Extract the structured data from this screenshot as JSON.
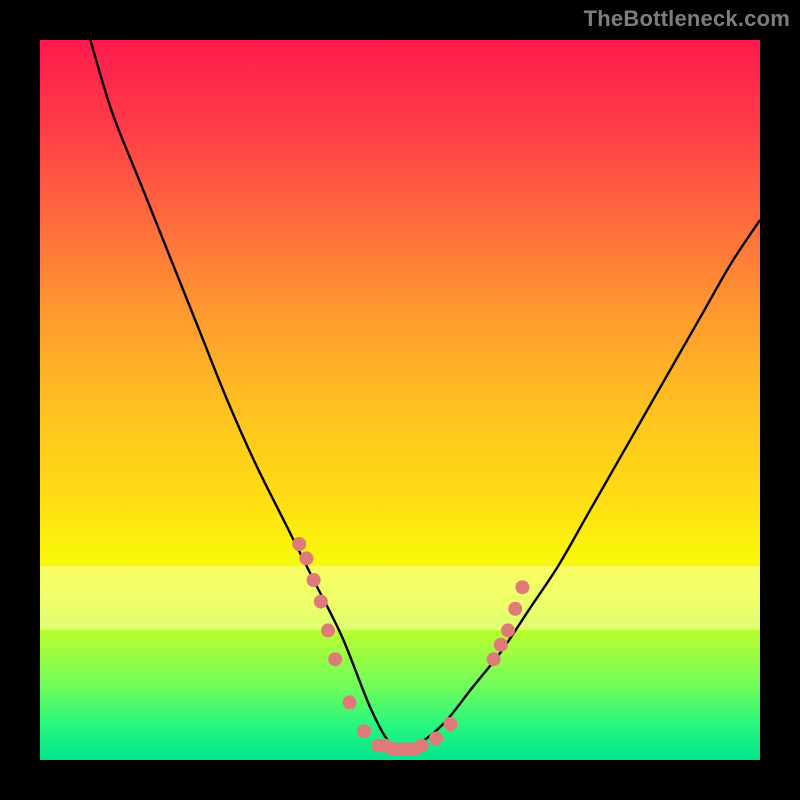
{
  "watermark": "TheBottleneck.com",
  "colors": {
    "frame": "#000000",
    "curve": "#000000",
    "dot": "#e07a7a",
    "gradient_top": "#ff1a4d",
    "gradient_bottom": "#00e58f",
    "band": "#fff89e"
  },
  "chart_data": {
    "type": "line",
    "title": "",
    "xlabel": "",
    "ylabel": "",
    "xlim": [
      0,
      100
    ],
    "ylim": [
      0,
      100
    ],
    "note": "Values are percentages of plot height from the TOP (0=top, 100=bottom). Curve is a V-shape with minimum (highest on screen) at the left edge and near-baseline trough around x≈49.",
    "series": [
      {
        "name": "curve",
        "x_pct": [
          7,
          10,
          14,
          18,
          22,
          26,
          30,
          34,
          38,
          42,
          46,
          49,
          52,
          56,
          60,
          64,
          68,
          72,
          76,
          80,
          84,
          88,
          92,
          96,
          100
        ],
        "y_from_top_pct": [
          0,
          10,
          20,
          30,
          40,
          50,
          59,
          67,
          75,
          83,
          93,
          98,
          98,
          95,
          90,
          85,
          79,
          73,
          66,
          59,
          52,
          45,
          38,
          31,
          25
        ]
      }
    ],
    "dots": {
      "note": "Pink scatter dots near the trough of the V curve",
      "x_pct": [
        36,
        37,
        38,
        39,
        40,
        41,
        43,
        45,
        47,
        48,
        49,
        50,
        51,
        52,
        53,
        55,
        57,
        63,
        64,
        65,
        66,
        67
      ],
      "y_from_top_pct": [
        70,
        72,
        75,
        78,
        82,
        86,
        92,
        96,
        98,
        98,
        98.5,
        98.5,
        98.5,
        98.5,
        98,
        97,
        95,
        86,
        84,
        82,
        79,
        76
      ]
    },
    "highlight_band_from_top_pct": [
      73,
      82
    ]
  }
}
